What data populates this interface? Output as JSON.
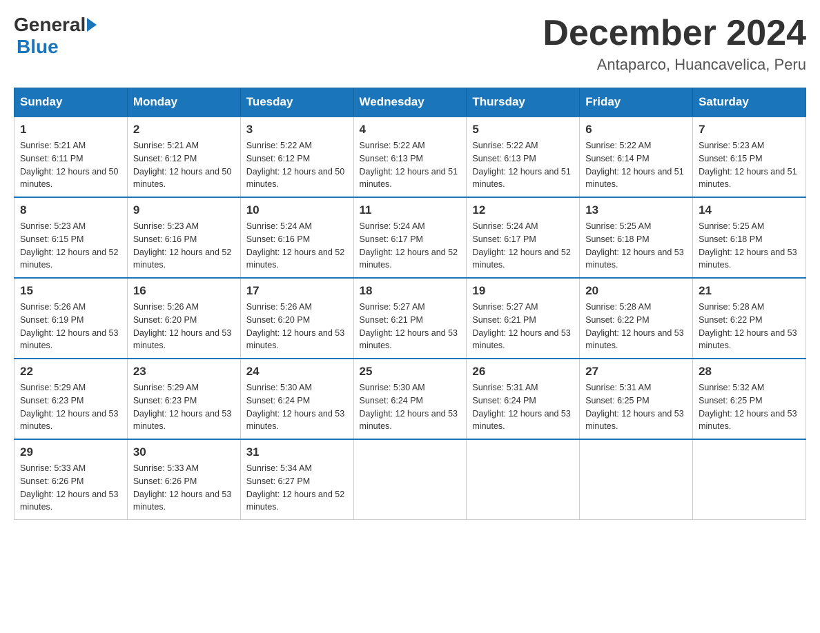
{
  "header": {
    "logo_general": "General",
    "logo_blue": "Blue",
    "month_title": "December 2024",
    "location": "Antaparco, Huancavelica, Peru"
  },
  "weekdays": [
    "Sunday",
    "Monday",
    "Tuesday",
    "Wednesday",
    "Thursday",
    "Friday",
    "Saturday"
  ],
  "weeks": [
    [
      {
        "day": "1",
        "sunrise": "5:21 AM",
        "sunset": "6:11 PM",
        "daylight": "12 hours and 50 minutes."
      },
      {
        "day": "2",
        "sunrise": "5:21 AM",
        "sunset": "6:12 PM",
        "daylight": "12 hours and 50 minutes."
      },
      {
        "day": "3",
        "sunrise": "5:22 AM",
        "sunset": "6:12 PM",
        "daylight": "12 hours and 50 minutes."
      },
      {
        "day": "4",
        "sunrise": "5:22 AM",
        "sunset": "6:13 PM",
        "daylight": "12 hours and 51 minutes."
      },
      {
        "day": "5",
        "sunrise": "5:22 AM",
        "sunset": "6:13 PM",
        "daylight": "12 hours and 51 minutes."
      },
      {
        "day": "6",
        "sunrise": "5:22 AM",
        "sunset": "6:14 PM",
        "daylight": "12 hours and 51 minutes."
      },
      {
        "day": "7",
        "sunrise": "5:23 AM",
        "sunset": "6:15 PM",
        "daylight": "12 hours and 51 minutes."
      }
    ],
    [
      {
        "day": "8",
        "sunrise": "5:23 AM",
        "sunset": "6:15 PM",
        "daylight": "12 hours and 52 minutes."
      },
      {
        "day": "9",
        "sunrise": "5:23 AM",
        "sunset": "6:16 PM",
        "daylight": "12 hours and 52 minutes."
      },
      {
        "day": "10",
        "sunrise": "5:24 AM",
        "sunset": "6:16 PM",
        "daylight": "12 hours and 52 minutes."
      },
      {
        "day": "11",
        "sunrise": "5:24 AM",
        "sunset": "6:17 PM",
        "daylight": "12 hours and 52 minutes."
      },
      {
        "day": "12",
        "sunrise": "5:24 AM",
        "sunset": "6:17 PM",
        "daylight": "12 hours and 52 minutes."
      },
      {
        "day": "13",
        "sunrise": "5:25 AM",
        "sunset": "6:18 PM",
        "daylight": "12 hours and 53 minutes."
      },
      {
        "day": "14",
        "sunrise": "5:25 AM",
        "sunset": "6:18 PM",
        "daylight": "12 hours and 53 minutes."
      }
    ],
    [
      {
        "day": "15",
        "sunrise": "5:26 AM",
        "sunset": "6:19 PM",
        "daylight": "12 hours and 53 minutes."
      },
      {
        "day": "16",
        "sunrise": "5:26 AM",
        "sunset": "6:20 PM",
        "daylight": "12 hours and 53 minutes."
      },
      {
        "day": "17",
        "sunrise": "5:26 AM",
        "sunset": "6:20 PM",
        "daylight": "12 hours and 53 minutes."
      },
      {
        "day": "18",
        "sunrise": "5:27 AM",
        "sunset": "6:21 PM",
        "daylight": "12 hours and 53 minutes."
      },
      {
        "day": "19",
        "sunrise": "5:27 AM",
        "sunset": "6:21 PM",
        "daylight": "12 hours and 53 minutes."
      },
      {
        "day": "20",
        "sunrise": "5:28 AM",
        "sunset": "6:22 PM",
        "daylight": "12 hours and 53 minutes."
      },
      {
        "day": "21",
        "sunrise": "5:28 AM",
        "sunset": "6:22 PM",
        "daylight": "12 hours and 53 minutes."
      }
    ],
    [
      {
        "day": "22",
        "sunrise": "5:29 AM",
        "sunset": "6:23 PM",
        "daylight": "12 hours and 53 minutes."
      },
      {
        "day": "23",
        "sunrise": "5:29 AM",
        "sunset": "6:23 PM",
        "daylight": "12 hours and 53 minutes."
      },
      {
        "day": "24",
        "sunrise": "5:30 AM",
        "sunset": "6:24 PM",
        "daylight": "12 hours and 53 minutes."
      },
      {
        "day": "25",
        "sunrise": "5:30 AM",
        "sunset": "6:24 PM",
        "daylight": "12 hours and 53 minutes."
      },
      {
        "day": "26",
        "sunrise": "5:31 AM",
        "sunset": "6:24 PM",
        "daylight": "12 hours and 53 minutes."
      },
      {
        "day": "27",
        "sunrise": "5:31 AM",
        "sunset": "6:25 PM",
        "daylight": "12 hours and 53 minutes."
      },
      {
        "day": "28",
        "sunrise": "5:32 AM",
        "sunset": "6:25 PM",
        "daylight": "12 hours and 53 minutes."
      }
    ],
    [
      {
        "day": "29",
        "sunrise": "5:33 AM",
        "sunset": "6:26 PM",
        "daylight": "12 hours and 53 minutes."
      },
      {
        "day": "30",
        "sunrise": "5:33 AM",
        "sunset": "6:26 PM",
        "daylight": "12 hours and 53 minutes."
      },
      {
        "day": "31",
        "sunrise": "5:34 AM",
        "sunset": "6:27 PM",
        "daylight": "12 hours and 52 minutes."
      },
      null,
      null,
      null,
      null
    ]
  ]
}
